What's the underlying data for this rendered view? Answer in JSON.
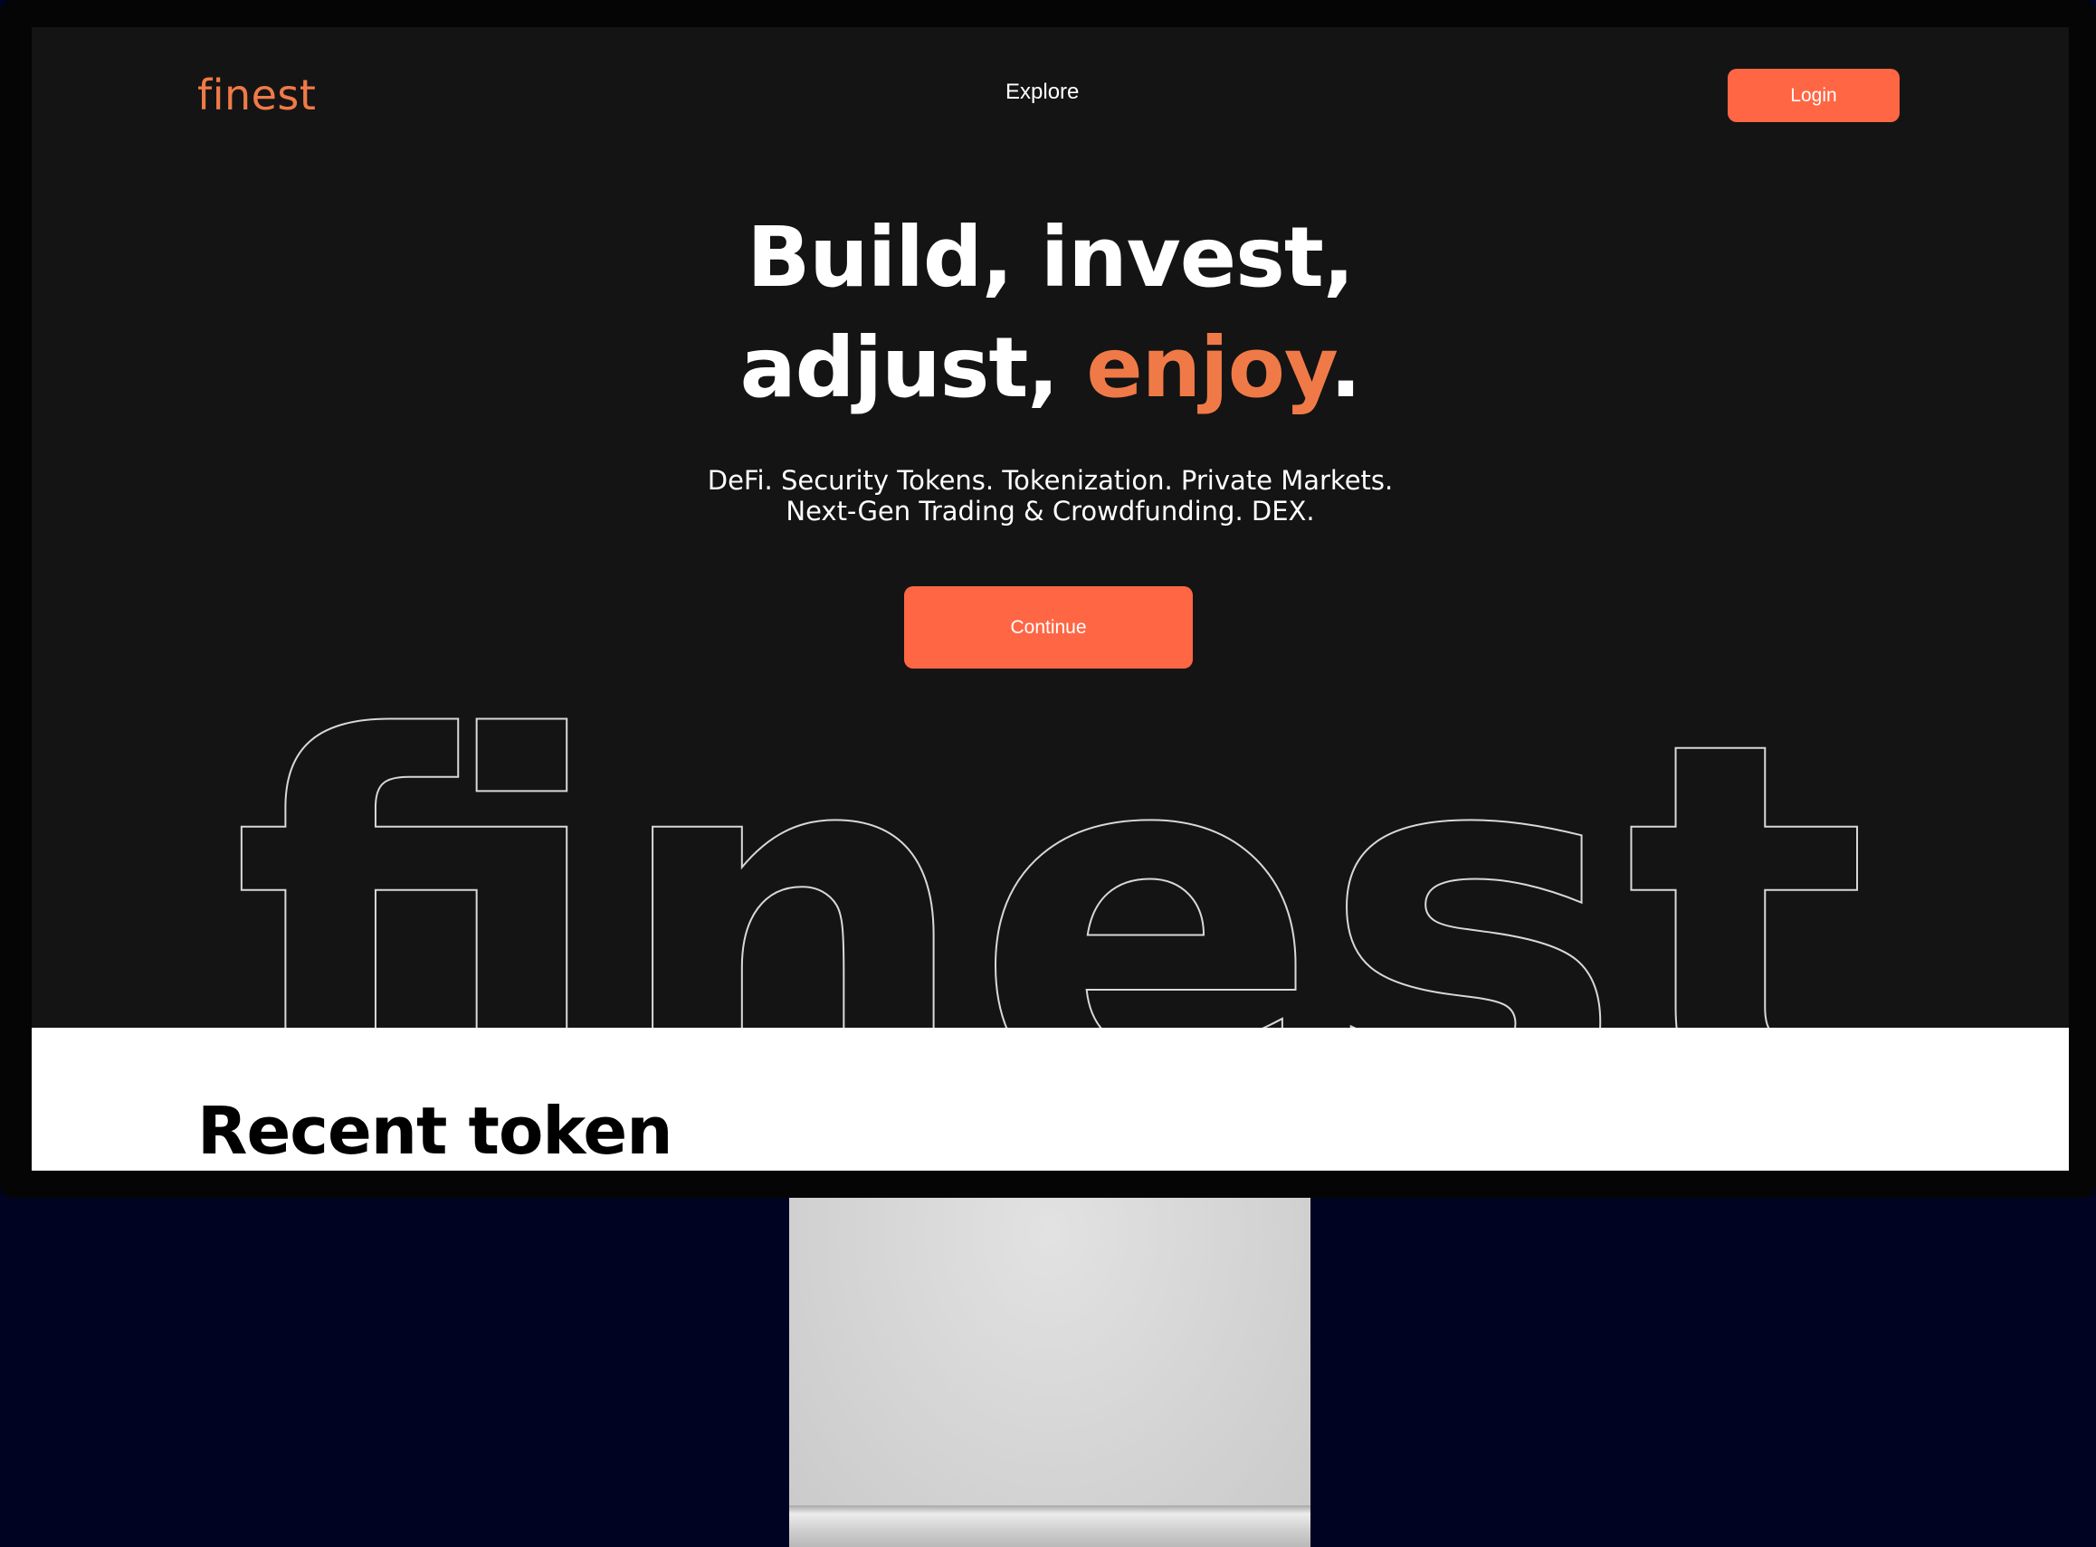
{
  "app": {
    "logo": "finest",
    "background_word": "finest"
  },
  "nav": {
    "explore_label": "Explore",
    "login_label": "Login"
  },
  "hero": {
    "title_line1": "Build, invest,",
    "title_line2_prefix": "adjust, ",
    "title_line2_accent": "enjoy",
    "title_line2_suffix": ".",
    "subtitle_line1": "DeFi. Security Tokens. Tokenization. Private Markets.",
    "subtitle_line2": "Next-Gen Trading & Crowdfunding. DEX.",
    "continue_label": "Continue"
  },
  "recent": {
    "heading": "Recent token"
  },
  "colors": {
    "accent": "#f07a47",
    "button": "#ff6644",
    "hero_bg": "#141414",
    "page_bg": "#010322"
  }
}
